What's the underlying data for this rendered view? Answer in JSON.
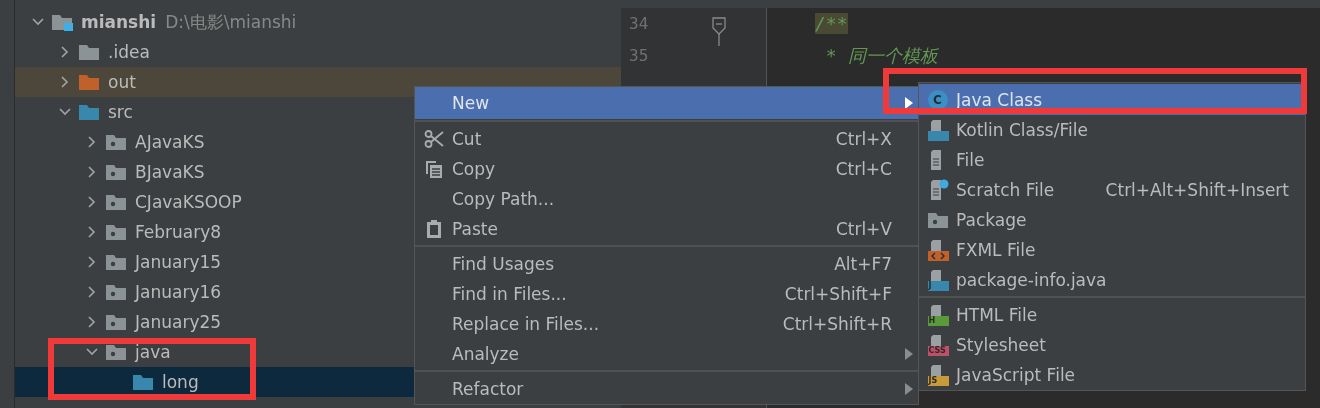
{
  "project_tree": {
    "root": {
      "name": "mianshi",
      "path": "D:\\电影\\mianshi",
      "kind": "module",
      "expanded": true,
      "selected": false,
      "children": [
        {
          "name": ".idea",
          "kind": "folder",
          "expanded": false,
          "selected": false
        },
        {
          "name": "out",
          "kind": "excluded",
          "expanded": false,
          "selected": false
        },
        {
          "name": "src",
          "kind": "source",
          "expanded": true,
          "selected": false,
          "children": [
            {
              "name": "AJavaKS",
              "kind": "package",
              "expanded": false,
              "selected": false
            },
            {
              "name": "BJavaKS",
              "kind": "package",
              "expanded": false,
              "selected": false
            },
            {
              "name": "CJavaKSOOP",
              "kind": "package",
              "expanded": false,
              "selected": false
            },
            {
              "name": "February8",
              "kind": "package",
              "expanded": false,
              "selected": false
            },
            {
              "name": "January15",
              "kind": "package",
              "expanded": false,
              "selected": false
            },
            {
              "name": "January16",
              "kind": "package",
              "expanded": false,
              "selected": false
            },
            {
              "name": "January25",
              "kind": "package",
              "expanded": false,
              "selected": false
            },
            {
              "name": "java",
              "kind": "package",
              "expanded": true,
              "selected": false,
              "children": [
                {
                  "name": "long",
                  "kind": "source",
                  "selected": true
                }
              ]
            }
          ]
        }
      ]
    }
  },
  "editor": {
    "lines": [
      {
        "number": "34",
        "text": "/**",
        "highlighted": true
      },
      {
        "number": "35",
        "text": " * 同一个模板",
        "highlighted": false
      }
    ]
  },
  "context_menu": {
    "items": [
      {
        "label": "New",
        "submenu": true,
        "selected": true
      },
      {
        "label": "Cut",
        "shortcut": "Ctrl+X",
        "selected": false,
        "separator_before": true
      },
      {
        "label": "Copy",
        "shortcut": "Ctrl+C",
        "selected": false
      },
      {
        "label": "Copy Path...",
        "selected": false
      },
      {
        "label": "Paste",
        "shortcut": "Ctrl+V",
        "selected": false
      },
      {
        "label": "Find Usages",
        "shortcut": "Alt+F7",
        "selected": false,
        "separator_before": true
      },
      {
        "label": "Find in Files...",
        "shortcut": "Ctrl+Shift+F",
        "selected": false
      },
      {
        "label": "Replace in Files...",
        "shortcut": "Ctrl+Shift+R",
        "selected": false
      },
      {
        "label": "Analyze",
        "submenu": true,
        "selected": false
      },
      {
        "label": "Refactor",
        "submenu": true,
        "selected": false,
        "separator_before": true
      }
    ]
  },
  "new_submenu": {
    "items": [
      {
        "label": "Java Class",
        "badge": "C",
        "selected": true
      },
      {
        "label": "Kotlin Class/File",
        "selected": false
      },
      {
        "label": "File",
        "selected": false
      },
      {
        "label": "Scratch File",
        "shortcut": "Ctrl+Alt+Shift+Insert",
        "selected": false
      },
      {
        "label": "Package",
        "selected": false
      },
      {
        "label": "FXML File",
        "selected": false
      },
      {
        "label": "package-info.java",
        "badge": "J",
        "selected": false
      },
      {
        "label": "HTML File",
        "badge": "H",
        "selected": false,
        "separator_before": true
      },
      {
        "label": "Stylesheet",
        "badge": "CSS",
        "selected": false
      },
      {
        "label": "JavaScript File",
        "badge": "JS",
        "selected": false
      }
    ]
  }
}
